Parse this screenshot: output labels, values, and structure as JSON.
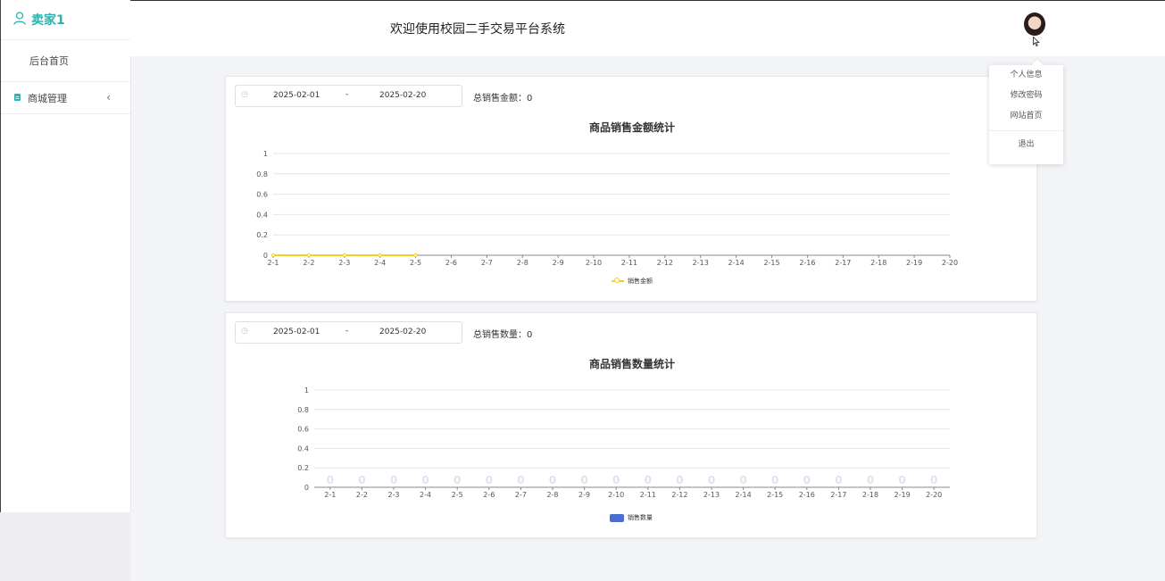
{
  "sidebar": {
    "username": "卖家1",
    "items": [
      {
        "label": "后台首页"
      },
      {
        "label": "商城管理"
      }
    ]
  },
  "header": {
    "title": "欢迎使用校园二手交易平台系统"
  },
  "dropdown": {
    "items": [
      "个人信息",
      "修改密码",
      "网站首页"
    ],
    "logout": "退出"
  },
  "sales_amount": {
    "start_date": "2025-02-01",
    "end_date": "2025-02-20",
    "separator": "-",
    "total_label": "总销售金额：",
    "total_value": "0",
    "chart_title": "商品销售金额统计",
    "legend": "销售金额"
  },
  "sales_quantity": {
    "start_date": "2025-02-01",
    "end_date": "2025-02-20",
    "separator": "-",
    "total_label": "总销售数量：",
    "total_value": "0",
    "chart_title": "商品销售数量统计",
    "legend": "销售数量"
  },
  "colors": {
    "accent": "#2bb3b0",
    "line_series": "#f0d020",
    "bar_series": "#4b6fd0"
  },
  "chart_data": [
    {
      "type": "line",
      "title": "商品销售金额统计",
      "categories": [
        "2-1",
        "2-2",
        "2-3",
        "2-4",
        "2-5",
        "2-6",
        "2-7",
        "2-8",
        "2-9",
        "2-10",
        "2-11",
        "2-12",
        "2-13",
        "2-14",
        "2-15",
        "2-16",
        "2-17",
        "2-18",
        "2-19",
        "2-20"
      ],
      "series": [
        {
          "name": "销售金额",
          "values": [
            0,
            0,
            0,
            0,
            0
          ]
        }
      ],
      "yticks": [
        "0",
        "0.2",
        "0.4",
        "0.6",
        "0.8",
        "1"
      ],
      "ylim": [
        0,
        1
      ],
      "grid": true,
      "legend_position": "bottom"
    },
    {
      "type": "bar",
      "title": "商品销售数量统计",
      "categories": [
        "2-1",
        "2-2",
        "2-3",
        "2-4",
        "2-5",
        "2-6",
        "2-7",
        "2-8",
        "2-9",
        "2-10",
        "2-11",
        "2-12",
        "2-13",
        "2-14",
        "2-15",
        "2-16",
        "2-17",
        "2-18",
        "2-19",
        "2-20"
      ],
      "series": [
        {
          "name": "销售数量",
          "values": [
            0,
            0,
            0,
            0,
            0,
            0,
            0,
            0,
            0,
            0,
            0,
            0,
            0,
            0,
            0,
            0,
            0,
            0,
            0,
            0
          ]
        }
      ],
      "data_labels": [
        "0",
        "0",
        "0",
        "0",
        "0",
        "0",
        "0",
        "0",
        "0",
        "0",
        "0",
        "0",
        "0",
        "0",
        "0",
        "0",
        "0",
        "0",
        "0",
        "0"
      ],
      "yticks": [
        "0",
        "0.2",
        "0.4",
        "0.6",
        "0.8",
        "1"
      ],
      "ylim": [
        0,
        1
      ],
      "grid": true,
      "legend_position": "bottom"
    }
  ]
}
